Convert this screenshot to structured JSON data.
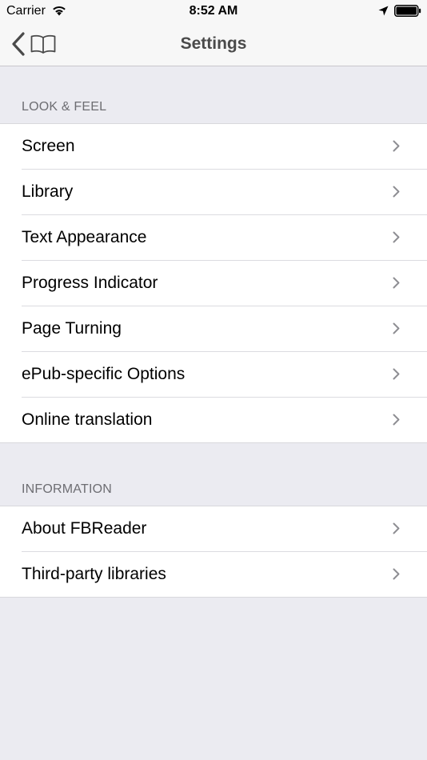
{
  "status_bar": {
    "carrier": "Carrier",
    "time": "8:52 AM"
  },
  "nav": {
    "title": "Settings",
    "back_icons": [
      "chevron-left-icon",
      "book-icon"
    ]
  },
  "sections": [
    {
      "header": "LOOK & FEEL",
      "items": [
        {
          "label": "Screen"
        },
        {
          "label": "Library"
        },
        {
          "label": "Text Appearance"
        },
        {
          "label": "Progress Indicator"
        },
        {
          "label": "Page Turning"
        },
        {
          "label": "ePub-specific Options"
        },
        {
          "label": "Online translation"
        }
      ]
    },
    {
      "header": "INFORMATION",
      "items": [
        {
          "label": "About FBReader"
        },
        {
          "label": "Third-party libraries"
        }
      ]
    }
  ],
  "colors": {
    "background": "#ebebf1",
    "nav_background": "#f7f7f7",
    "section_header": "#6d6d72",
    "chevron": "#8e8e93",
    "title": "#4a4a4a"
  }
}
